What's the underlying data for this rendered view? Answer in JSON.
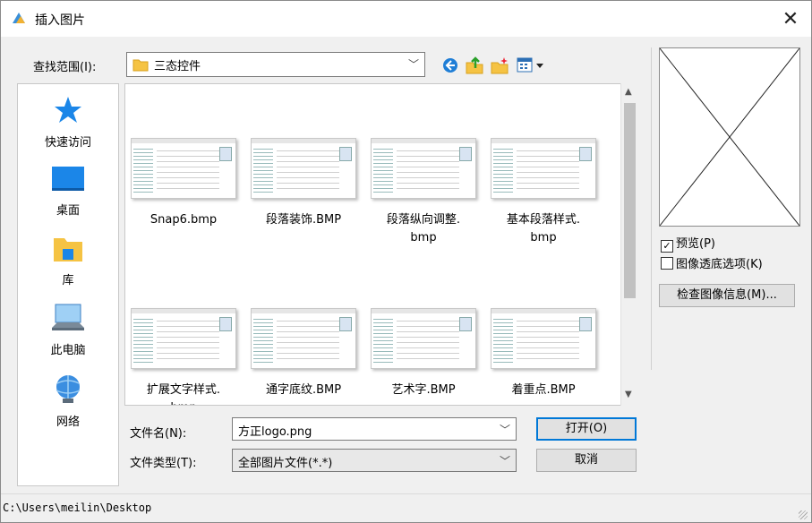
{
  "dialog": {
    "title": "插入图片",
    "close_glyph": "✕"
  },
  "lookin": {
    "label": "查找范围(I):",
    "value": "三态控件"
  },
  "places": [
    {
      "label": "快速访问",
      "icon": "star-icon"
    },
    {
      "label": "桌面",
      "icon": "desktop-icon"
    },
    {
      "label": "库",
      "icon": "library-icon"
    },
    {
      "label": "此电脑",
      "icon": "computer-icon"
    },
    {
      "label": "网络",
      "icon": "network-icon"
    }
  ],
  "files": [
    {
      "name": "Snap6.bmp"
    },
    {
      "name": "段落装饰.BMP"
    },
    {
      "name": "段落纵向调整.\nbmp"
    },
    {
      "name": "基本段落样式.\nbmp"
    },
    {
      "name": "扩展文字样式.\nbmp"
    },
    {
      "name": "通字底纹.BMP"
    },
    {
      "name": "艺术字.BMP"
    },
    {
      "name": "着重点.BMP"
    }
  ],
  "filename": {
    "label": "文件名(N):",
    "value": "方正logo.png"
  },
  "filetype": {
    "label": "文件类型(T):",
    "value": "全部图片文件(*.*)"
  },
  "buttons": {
    "open": "打开(O)",
    "cancel": "取消",
    "image_info": "检查图像信息(M)..."
  },
  "options": {
    "preview_label": "预览(P)",
    "preview_checked": true,
    "transparent_label": "图像透底选项(K)",
    "transparent_checked": false
  },
  "status": {
    "path": "C:\\Users\\meilin\\Desktop"
  },
  "colors": {
    "accent": "#0078d7",
    "folder": "#f5c343"
  }
}
